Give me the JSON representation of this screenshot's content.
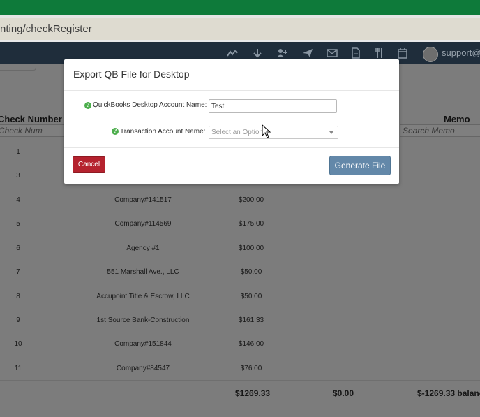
{
  "browser": {
    "url_fragment": "nting/checkRegister"
  },
  "navbar": {
    "icons": [
      "chart-line-icon",
      "download-icon",
      "add-user-icon",
      "send-icon",
      "mail-icon",
      "document-icon",
      "utensils-icon",
      "calendar-icon"
    ],
    "user_label": "support@je"
  },
  "table": {
    "columns": {
      "check_number": "Check Number",
      "memo": "Memo"
    },
    "filters": {
      "check_num_placeholder": "Check Num",
      "memo_placeholder": "Search Memo"
    },
    "rows": [
      {
        "num": "1",
        "payee": "",
        "amount": ""
      },
      {
        "num": "3",
        "payee": "",
        "amount": ""
      },
      {
        "num": "4",
        "payee": "Company#141517",
        "amount": "$200.00"
      },
      {
        "num": "5",
        "payee": "Company#114569",
        "amount": "$175.00"
      },
      {
        "num": "6",
        "payee": "Agency #1",
        "amount": "$100.00"
      },
      {
        "num": "7",
        "payee": "551 Marshall Ave., LLC",
        "amount": "$50.00"
      },
      {
        "num": "8",
        "payee": "Accupoint Title & Escrow, LLC",
        "amount": "$50.00"
      },
      {
        "num": "9",
        "payee": "1st Source Bank-Construction",
        "amount": "$161.33"
      },
      {
        "num": "10",
        "payee": "Company#151844",
        "amount": "$146.00"
      },
      {
        "num": "11",
        "payee": "Company#84547",
        "amount": "$76.00"
      }
    ],
    "totals": {
      "amount": "$1269.33",
      "second": "$0.00",
      "balance": "$-1269.33 balanc"
    }
  },
  "modal": {
    "title": "Export QB File for Desktop",
    "help_glyph": "?",
    "fields": {
      "account_name_label": "QuickBooks Desktop Account Name:",
      "account_name_value": "Test",
      "transaction_account_label": "Transaction Account Name:",
      "transaction_account_placeholder": "Select an Option"
    },
    "buttons": {
      "cancel": "Cancel",
      "generate": "Generate File"
    }
  },
  "colors": {
    "browser_green": "#0e7a3a",
    "navbar": "#1f2d3b",
    "cancel_red": "#b5222e",
    "generate_blue": "#6388a9",
    "help_green": "#4cae4c"
  }
}
